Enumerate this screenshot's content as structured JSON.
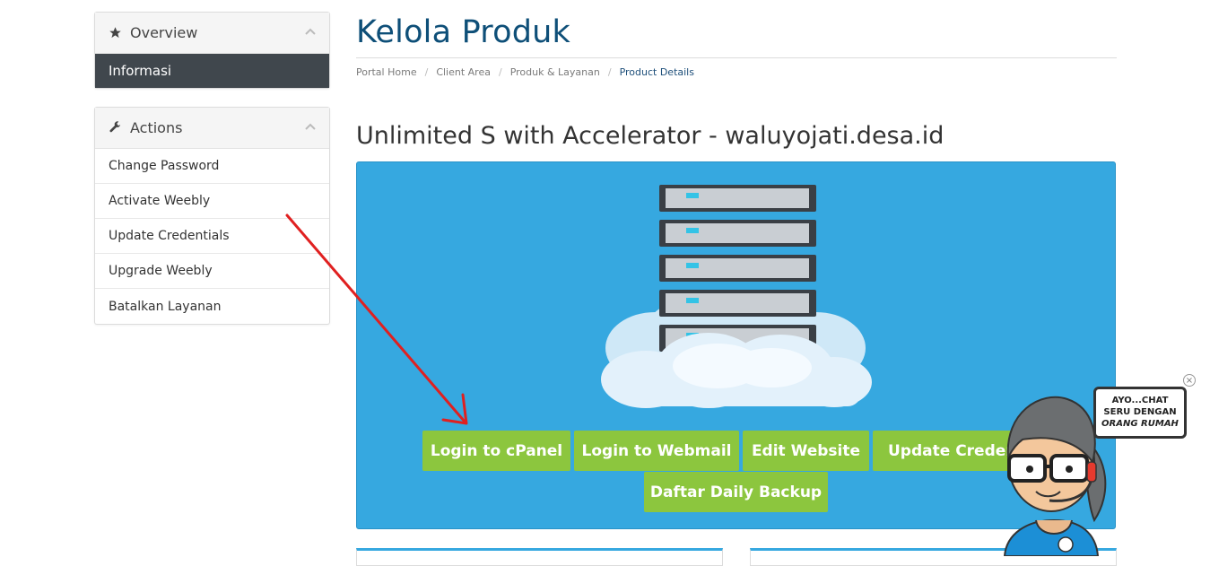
{
  "sidebar": {
    "overview": {
      "title": "Overview",
      "active_item": "Informasi"
    },
    "actions": {
      "title": "Actions",
      "items": [
        "Change Password",
        "Activate Weebly",
        "Update Credentials",
        "Upgrade Weebly",
        "Batalkan Layanan"
      ]
    }
  },
  "main": {
    "page_title": "Kelola Produk",
    "breadcrumb": [
      "Portal Home",
      "Client Area",
      "Produk & Layanan",
      "Product Details"
    ],
    "product_title": "Unlimited S with Accelerator - waluyojati.desa.id",
    "buttons": {
      "cpanel": "Login to cPanel",
      "webmail": "Login to Webmail",
      "edit_website": "Edit Website",
      "update_credentials": "Update Credentials",
      "daily_backup": "Daftar Daily Backup"
    }
  },
  "chat_widget": {
    "line1": "AYO...CHAT",
    "line2": "SERU DENGAN",
    "line3": "ORANG RUMAH",
    "close": "×"
  },
  "colors": {
    "accent_blue": "#36a8e0",
    "button_green": "#8cc63e",
    "title_blue": "#0e4f78",
    "active_dark": "#40474d",
    "annotation_red": "#e02020"
  },
  "icons": {
    "overview": "star-icon",
    "actions": "wrench-icon",
    "collapse": "chevron-up-icon"
  }
}
